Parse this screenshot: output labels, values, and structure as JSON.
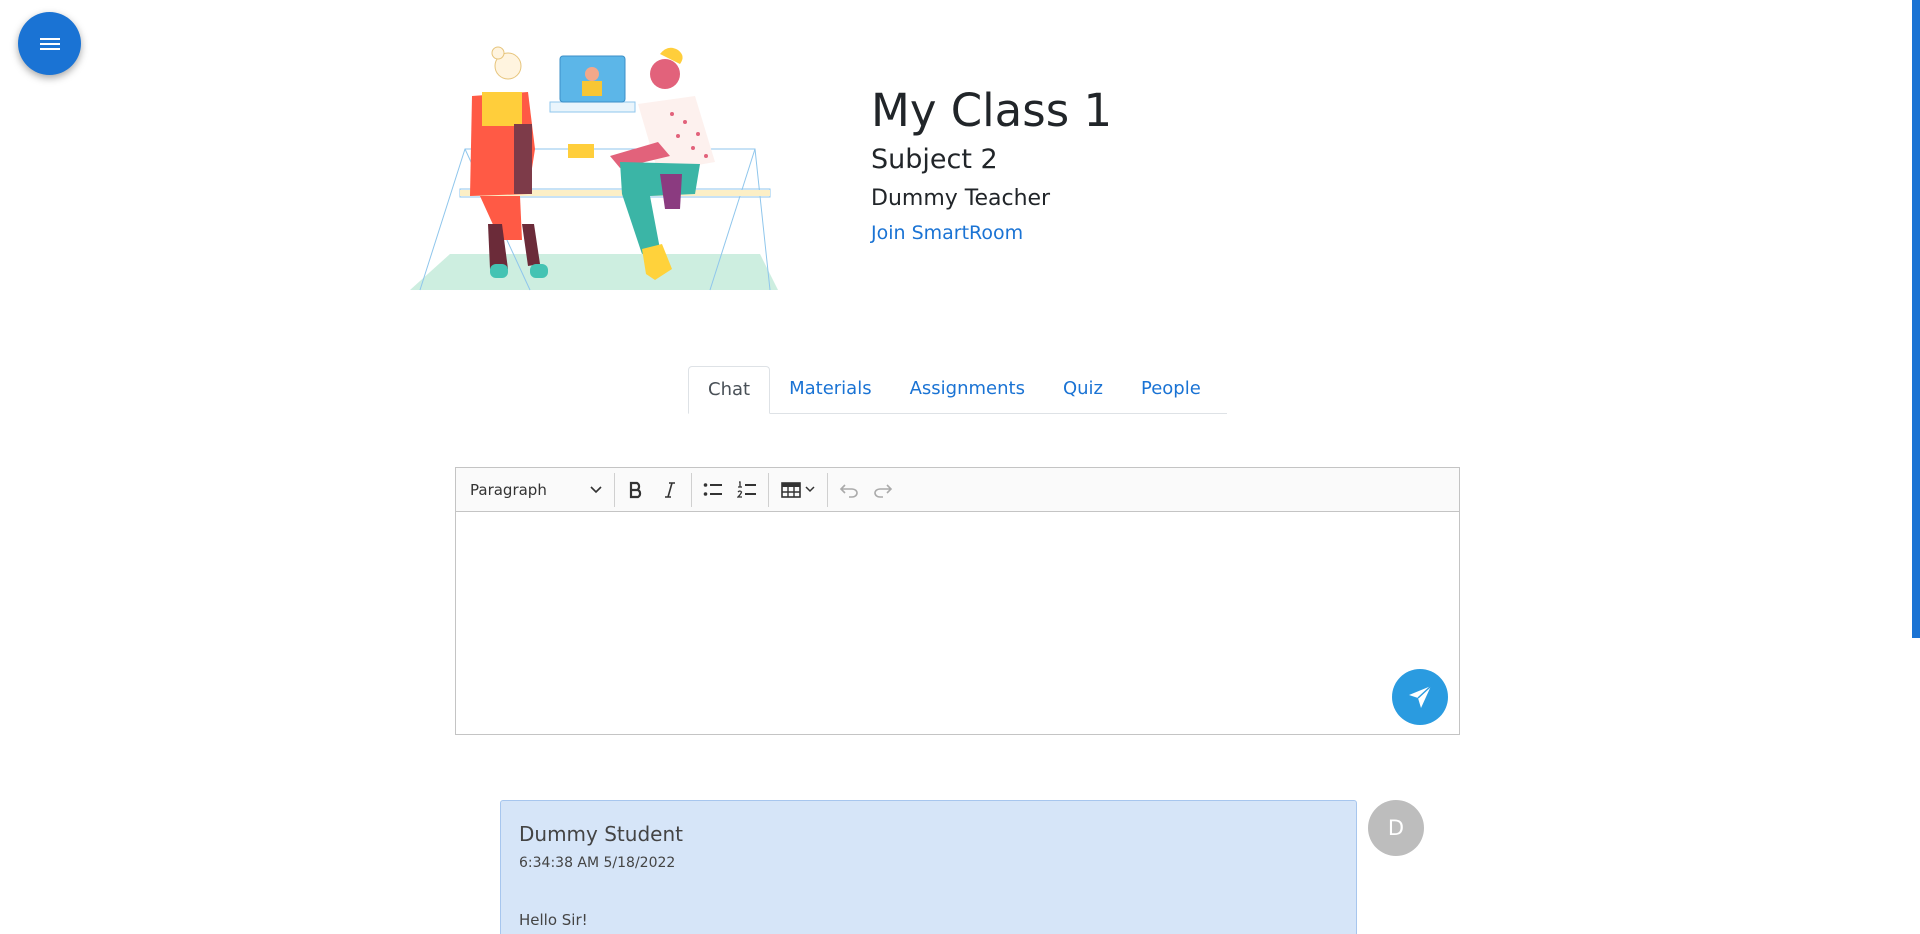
{
  "menu": {
    "icon": "hamburger-menu-icon"
  },
  "header": {
    "illustration": "two-people-at-laptop-illustration",
    "class_title": "My Class 1",
    "subject": "Subject 2",
    "teacher": "Dummy Teacher",
    "join_link": "Join SmartRoom"
  },
  "tabs": [
    {
      "label": "Chat",
      "active": true
    },
    {
      "label": "Materials",
      "active": false
    },
    {
      "label": "Assignments",
      "active": false
    },
    {
      "label": "Quiz",
      "active": false
    },
    {
      "label": "People",
      "active": false
    }
  ],
  "editor": {
    "heading_select": "Paragraph",
    "toolbar_icons": [
      "bold-icon",
      "italic-icon",
      "bulleted-list-icon",
      "numbered-list-icon",
      "table-icon",
      "undo-icon",
      "redo-icon"
    ],
    "content": "",
    "send_icon": "send-icon"
  },
  "messages": [
    {
      "author": "Dummy Student",
      "time": "6:34:38 AM 5/18/2022",
      "body": "Hello Sir!",
      "avatar_initial": "D"
    }
  ],
  "colors": {
    "accent": "#1a73d4",
    "send_button": "#2a9be0",
    "message_bg": "#d6e5f8",
    "avatar_bg": "#bdbdbd"
  }
}
